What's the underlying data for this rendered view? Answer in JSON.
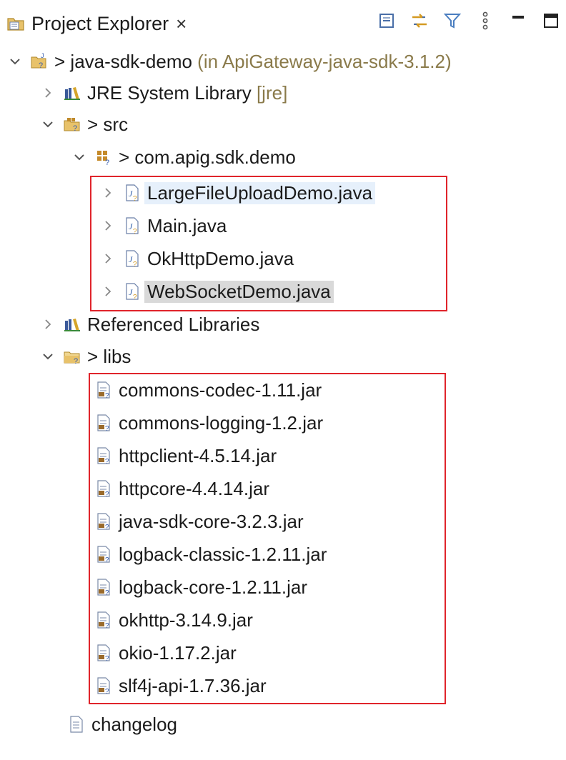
{
  "panel": {
    "title": "Project Explorer",
    "close_glyph": "×",
    "toolbar_icons": [
      "collapse-all-icon",
      "link-with-editor-icon",
      "filter-icon",
      "view-menu-icon",
      "minimize-icon",
      "maximize-icon"
    ]
  },
  "tree": {
    "project": {
      "prefix": "> ",
      "name": "java-sdk-demo",
      "suffix": " (in ApiGateway-java-sdk-3.1.2)"
    },
    "jre": {
      "name": "JRE System Library",
      "suffix": " [jre]"
    },
    "src": {
      "prefix": "> ",
      "name": "src"
    },
    "package": {
      "prefix": "> ",
      "name": "com.apig.sdk.demo"
    },
    "java_files": [
      "LargeFileUploadDemo.java",
      "Main.java",
      "OkHttpDemo.java",
      "WebSocketDemo.java"
    ],
    "referenced": {
      "name": "Referenced Libraries"
    },
    "libs": {
      "prefix": "> ",
      "name": "libs"
    },
    "jars": [
      "commons-codec-1.11.jar",
      "commons-logging-1.2.jar",
      "httpclient-4.5.14.jar",
      "httpcore-4.4.14.jar",
      "java-sdk-core-3.2.3.jar",
      "logback-classic-1.2.11.jar",
      "logback-core-1.2.11.jar",
      "okhttp-3.14.9.jar",
      "okio-1.17.2.jar",
      "slf4j-api-1.7.36.jar"
    ],
    "changelog": "changelog"
  },
  "colors": {
    "highlight_box": "#e0242b",
    "decoration_text": "#8a7a4a",
    "hover_row": "#e6f0fb",
    "selected_row": "#d9d9d9"
  }
}
